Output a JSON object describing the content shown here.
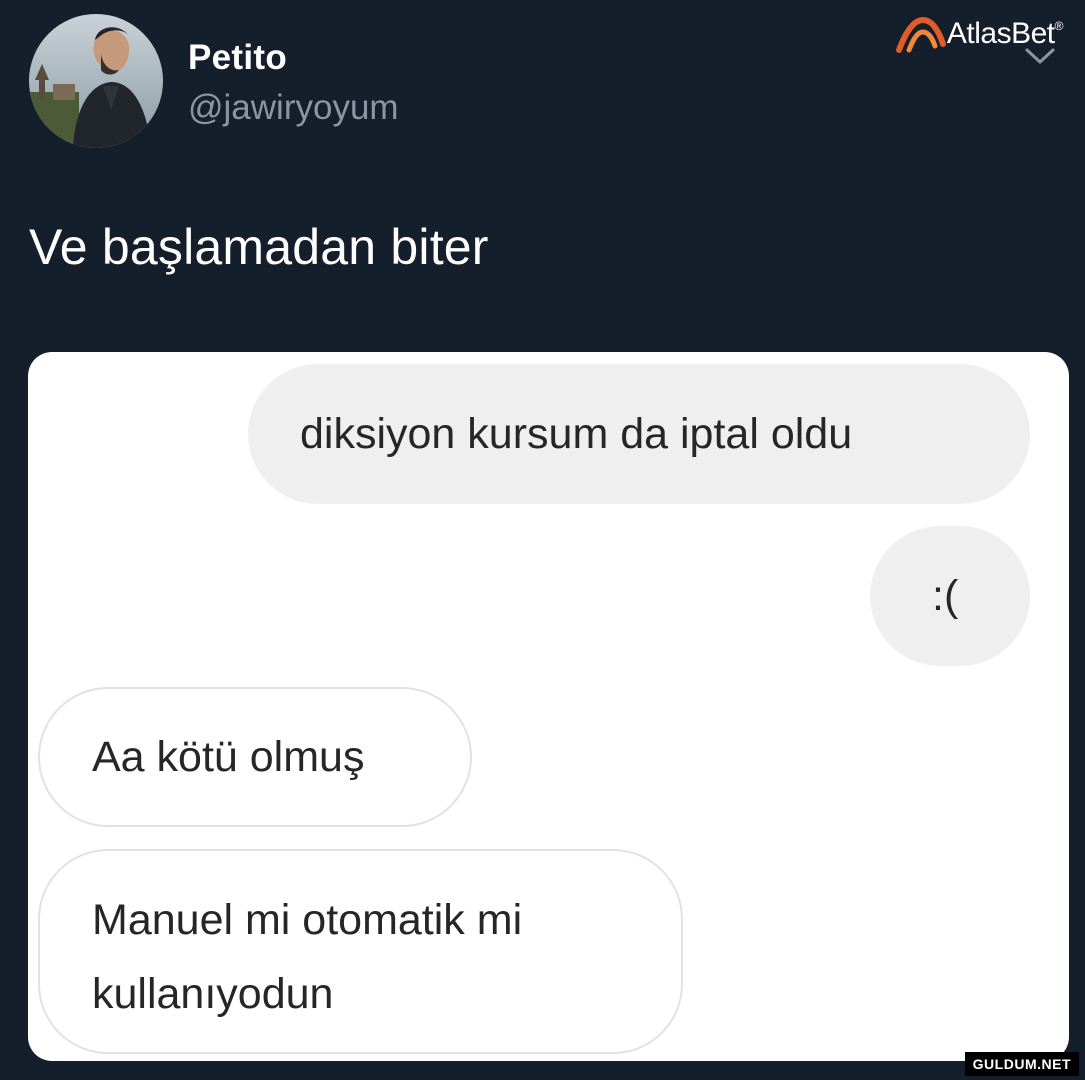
{
  "tweet": {
    "display_name": "Petito",
    "handle": "@jawiryoyum",
    "text": "Ve başlamadan biter",
    "avatar_icon": "profile-photo"
  },
  "brand": {
    "name": "AtlasBet",
    "registered_mark": "®",
    "accent_color": "#e25b2a"
  },
  "menu": {
    "icon": "chevron-down-icon"
  },
  "chat": {
    "messages": [
      {
        "direction": "outgoing",
        "text": "diksiyon kursum da iptal oldu"
      },
      {
        "direction": "outgoing",
        "text": ":("
      },
      {
        "direction": "incoming",
        "text": "Aa kötü olmuş"
      },
      {
        "direction": "incoming",
        "text": "Manuel mi otomatik mi kullanıyodun"
      }
    ]
  },
  "watermark": {
    "text": "GULDUM.NET"
  },
  "colors": {
    "background": "#151e2b",
    "handle": "#8a96a3",
    "outgoing_bubble": "#efefef",
    "incoming_border": "#e2e2e2"
  }
}
